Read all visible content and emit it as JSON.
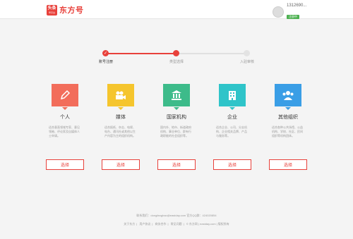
{
  "header": {
    "logo_badge": "头条",
    "logo_badge_sub": "号平台",
    "logo_text": "东方号",
    "user_name": "1312690...",
    "user_status": "注册中"
  },
  "steps": [
    {
      "label": "账号注册",
      "status": "done"
    },
    {
      "label": "类型选择",
      "status": "current"
    },
    {
      "label": "入驻审核",
      "status": "todo"
    }
  ],
  "cards": [
    {
      "title": "个人",
      "icon": "pencil-icon",
      "color": "#f26d5b",
      "description": "适合垂直领域专家、意见领袖、评论家及自媒体人士申请。",
      "button": "选择"
    },
    {
      "title": "媒体",
      "icon": "video-camera-icon",
      "color": "#f5c52d",
      "description": "适合报纸、杂志、电视、电台、通讯社或其他以生产内容为主的组织机构。",
      "button": "选择"
    },
    {
      "title": "国家机构",
      "icon": "government-building-icon",
      "color": "#3dbb8a",
      "description": "国内外、地市、街道政府机构、事业单位、群有行政职能的社会组织等。",
      "button": "选择"
    },
    {
      "title": "企业",
      "icon": "office-building-icon",
      "color": "#2fc4c9",
      "description": "适合企业、公司、分支机构、企业相关品牌、产品与服务等。",
      "button": "选择"
    },
    {
      "title": "其他组织",
      "icon": "people-group-icon",
      "color": "#3a9ee6",
      "description": "适合各种公共场馆、公益机构、学校、社区、民间组织等机构团体。",
      "button": "选择"
    }
  ],
  "footer": {
    "contact": "联系我们：dongfanghao@eastday.com    官方QQ群：424020854",
    "links": [
      "关于东方",
      "用户协议",
      "商务合作",
      "常见问题",
      "© 东方网 | eastday.com | 版权所有"
    ]
  },
  "colors": {
    "accent": "#e8413b",
    "inactive": "#e0e0e0"
  }
}
